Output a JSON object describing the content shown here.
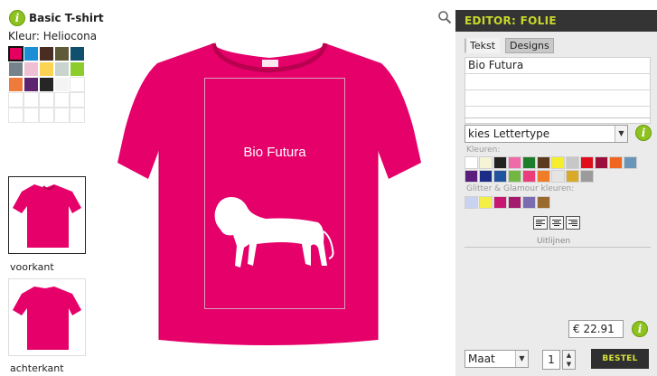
{
  "product": {
    "title": "Basic T-shirt",
    "info_icon": "info-icon",
    "color_label": "Kleur: Heliocona"
  },
  "swatches": [
    {
      "color": "#e5005f",
      "selected": true
    },
    {
      "color": "#1a8fd6"
    },
    {
      "color": "#4a2d22"
    },
    {
      "color": "#5f5a38"
    },
    {
      "color": "#114f6e"
    },
    {
      "color": "#74848a"
    },
    {
      "color": "#efc0d4"
    },
    {
      "color": "#fbd454"
    },
    {
      "color": "#c9d4ce"
    },
    {
      "color": "#8ccc2b"
    },
    {
      "color": "#ee7a3c"
    },
    {
      "color": "#5d2470"
    },
    {
      "color": "#262626"
    },
    {
      "color": "#f4f4f4"
    },
    {
      "color": ""
    },
    {
      "color": ""
    },
    {
      "color": ""
    },
    {
      "color": ""
    },
    {
      "color": ""
    },
    {
      "color": ""
    },
    {
      "color": ""
    },
    {
      "color": ""
    },
    {
      "color": ""
    },
    {
      "color": ""
    },
    {
      "color": ""
    }
  ],
  "views": {
    "front_label": "voorkant",
    "back_label": "achterkant"
  },
  "design": {
    "text": "Bio Futura",
    "shirt_color": "#e5006a",
    "zoom_icon": "magnifier-icon"
  },
  "editor": {
    "title": "EDITOR: FOLIE",
    "tabs": [
      {
        "label": "Tekst",
        "active": false
      },
      {
        "label": "Designs",
        "active": true
      }
    ],
    "text_lines": [
      "Bio Futura",
      "",
      "",
      ""
    ],
    "font_select": "kies Lettertype",
    "colors_label": "Kleuren:",
    "colors": [
      "#ffffff",
      "#f7f3d7",
      "#222222",
      "#f06aa8",
      "#1c7d2a",
      "#5b3a1e",
      "#f5ee2a",
      "#c7c7c7",
      "#e00d1a",
      "#9b0f3a",
      "#f06620",
      "#6b95b8",
      "#5b1e7d",
      "#1a2c85",
      "#20549e",
      "#73b743",
      "#ea3d7b",
      "#f07c2a",
      "#e4e4e4",
      "#d9a92a",
      "#9b9b9b"
    ],
    "glitter_label": "Glitter & Glamour kleuren:",
    "glitter_colors": [
      "#c9d3f0",
      "#f5ee47",
      "#c71773",
      "#a41a6d",
      "#7b6bb0",
      "#9b6a2e"
    ],
    "align_label": "Uitlijnen",
    "price": "€ 22.91",
    "size_select": "Maat",
    "quantity": "1",
    "order_label": "BESTEL"
  }
}
